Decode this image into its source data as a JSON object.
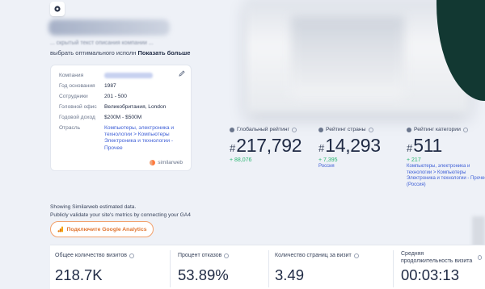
{
  "header": {
    "description_blurred": "... скрытый текст описания компании ...",
    "description_line2_prefix": "выбрать оптимального исполн",
    "show_more": "Показать больше"
  },
  "company_card": {
    "rows": [
      {
        "key": "Компания",
        "value": "",
        "blurred": true
      },
      {
        "key": "Год основания",
        "value": "1987"
      },
      {
        "key": "Сотрудники",
        "value": "201 - 500"
      },
      {
        "key": "Головной офис",
        "value": "Великобритания, London"
      },
      {
        "key": "Годовой доход",
        "value": "$200M - $500M"
      },
      {
        "key": "Отрасль",
        "value": "Компьютеры, электроника и технологии > Компьютеры Электроника и технологии - Прочее",
        "link": true
      }
    ],
    "brand": "similarweb"
  },
  "ranks": [
    {
      "title": "Глобальный рейтинг",
      "value": "217,792",
      "delta": "+ 88,076",
      "sub": ""
    },
    {
      "title": "Рейтинг страны",
      "value": "14,293",
      "delta": "+ 7,395",
      "sub": "Россия"
    },
    {
      "title": "Рейтинг категории",
      "value": "511",
      "delta": "+ 217",
      "sub": "Компьютеры, электроника и технологии > Компьютеры Электроника и технологии - Прочее (Россия)"
    }
  ],
  "note": {
    "line1": "Showing Similarweb estimated data.",
    "line2": "Publicly validate your site's metrics by connecting your GA4",
    "button": "Подключите Google Analytics"
  },
  "metrics": [
    {
      "label": "Общее количество визитов",
      "value": "218.7K"
    },
    {
      "label": "Процент отказов",
      "value": "53.89%"
    },
    {
      "label": "Количество страниц за визит",
      "value": "3.49"
    },
    {
      "label": "Средняя продолжительность визита",
      "value": "00:03:13"
    }
  ],
  "colors": {
    "accent": "#3e5fd6",
    "positive": "#2bb673",
    "ga_orange": "#e0742f",
    "dark_panel": "#123832"
  },
  "icons": [
    "gear-icon",
    "edit-pencil-icon",
    "globe-icon",
    "info-icon",
    "google-analytics-icon",
    "similarweb-logo-icon"
  ]
}
